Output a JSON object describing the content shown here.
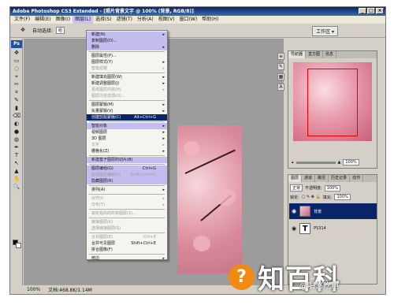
{
  "window": {
    "title": "Adobe Photoshop CS3 Extended - [照片背景文字 @ 100% (背景, RGB/8)]",
    "controls": [
      "_",
      "□",
      "×"
    ]
  },
  "menubar": {
    "items": [
      "文件(F)",
      "编辑(E)",
      "图像(I)",
      "图层(L)",
      "选择(S)",
      "滤镜(T)",
      "分析(A)",
      "视图(V)",
      "窗口(W)",
      "帮助(H)"
    ],
    "active_index": 3
  },
  "options": {
    "auto_select_label": "自动选择:",
    "auto_select_value": "组",
    "workspace_label": "工作区 ▾"
  },
  "layer_menu": {
    "items": [
      {
        "label": "新建(N)",
        "arrow": true,
        "hl": true
      },
      {
        "label": "复制图层(D)...",
        "hl": true
      },
      {
        "label": "删除",
        "arrow": true,
        "hl": true
      },
      {
        "sep": true
      },
      {
        "label": "图层属性(P)..."
      },
      {
        "label": "图层样式(Y)",
        "arrow": true
      },
      {
        "label": "智能滤镜",
        "arrow": true,
        "dis": true
      },
      {
        "sep": true
      },
      {
        "label": "新建填充图层(W)",
        "arrow": true
      },
      {
        "label": "新建调整图层(J)",
        "arrow": true
      },
      {
        "label": "更改图层内容(H)",
        "arrow": true,
        "dis": true
      },
      {
        "label": "图层内容选项(O)...",
        "dis": true
      },
      {
        "sep": true
      },
      {
        "label": "图层蒙版(M)",
        "arrow": true
      },
      {
        "label": "矢量蒙版(V)",
        "arrow": true
      },
      {
        "label": "创建剪贴蒙版(C)",
        "shortcut": "Alt+Ctrl+G",
        "sel": true
      },
      {
        "sep": true
      },
      {
        "label": "智能对象",
        "arrow": true,
        "hl": true
      },
      {
        "label": "视频图层",
        "arrow": true
      },
      {
        "label": "3D 图层",
        "arrow": true
      },
      {
        "label": "文字",
        "arrow": true,
        "dis": true
      },
      {
        "label": "栅格化(Z)",
        "arrow": true
      },
      {
        "sep": true
      },
      {
        "label": "新建基于图层的切片(B)",
        "hl": true
      },
      {
        "sep": true
      },
      {
        "label": "图层编组(G)",
        "shortcut": "Ctrl+G",
        "hl": true
      },
      {
        "label": "取消图层编组(U)",
        "shortcut": "Shift+Ctrl+G",
        "dis": true,
        "hl": true
      },
      {
        "label": "隐藏图层(R)",
        "hl": true
      },
      {
        "sep": true
      },
      {
        "label": "排列(A)",
        "arrow": true
      },
      {
        "sep": true
      },
      {
        "label": "对齐(I)",
        "arrow": true,
        "dis": true
      },
      {
        "label": "分布(T)",
        "arrow": true,
        "dis": true
      },
      {
        "sep": true
      },
      {
        "label": "锁定组内的所有图层(X)...",
        "dis": true
      },
      {
        "sep": true
      },
      {
        "label": "链接图层(K)",
        "dis": true
      },
      {
        "label": "选择链接图层(S)",
        "dis": true
      },
      {
        "sep": true
      },
      {
        "label": "合并图层(E)",
        "shortcut": "Ctrl+E",
        "dis": true
      },
      {
        "label": "合并可见图层",
        "shortcut": "Shift+Ctrl+E"
      },
      {
        "label": "拼合图像(F)"
      },
      {
        "sep": true
      },
      {
        "label": "修边",
        "arrow": true
      }
    ]
  },
  "navigator": {
    "tabs": [
      "导航器",
      "直方图",
      "信息"
    ],
    "zoom": "100%"
  },
  "layers": {
    "tabs": [
      "图层",
      "通道",
      "路径",
      "历史记录",
      "动作"
    ],
    "blend_mode": "正常",
    "opacity_label": "不透明度:",
    "opacity": "100%",
    "lock_label": "锁定:",
    "fill_label": "填充:",
    "fill": "100%",
    "items": [
      {
        "name": "背景",
        "type": "image",
        "active": true
      },
      {
        "name": "PS314",
        "type": "text",
        "active": false
      }
    ]
  },
  "status": {
    "zoom": "100%",
    "doc": "文档:468.8K/1.14M"
  },
  "watermark": {
    "logo": "?",
    "text": "知百科",
    "sub": "@唱悠吃朋"
  }
}
